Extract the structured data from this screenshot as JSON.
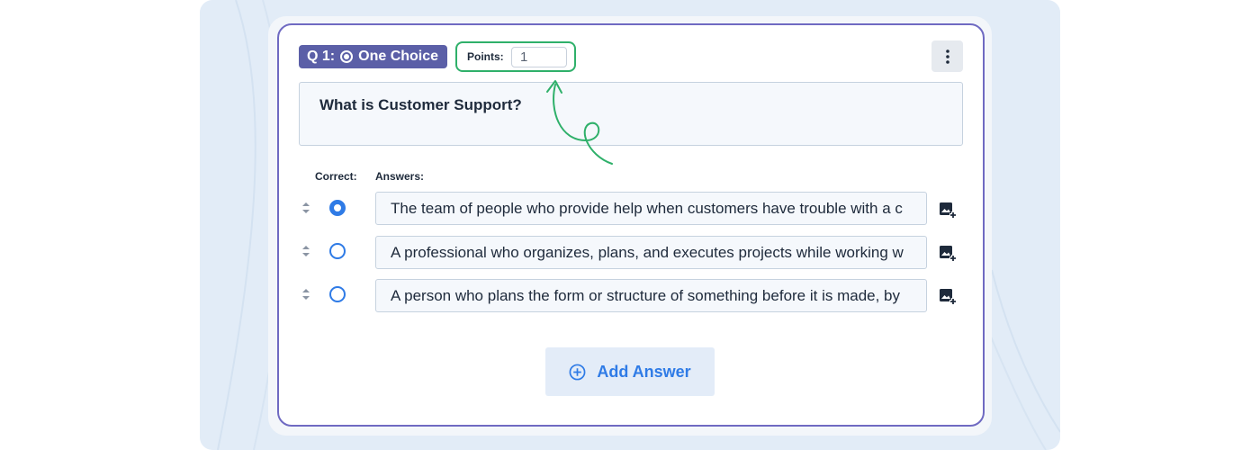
{
  "question": {
    "badge_prefix": "Q 1:",
    "type_label": "One Choice",
    "type_icon": "radio-icon",
    "points_label": "Points:",
    "points_value": "1",
    "menu_icon": "kebab-menu-icon",
    "text": "What is Customer Support?"
  },
  "answers_section": {
    "correct_header": "Correct:",
    "answers_header": "Answers:",
    "items": [
      {
        "text": "The team of people who provide help when customers have trouble with a c",
        "correct": true
      },
      {
        "text": "A professional who organizes, plans, and executes projects while working w",
        "correct": false
      },
      {
        "text": "A person who plans the form or structure of something before it is made, by",
        "correct": false
      }
    ],
    "drag_icon": "drag-handle-icon",
    "add_image_icon": "add-image-icon"
  },
  "add_answer": {
    "label": "Add Answer",
    "icon": "plus-circle-icon"
  },
  "colors": {
    "accent_blue": "#2f7be6",
    "badge_purple": "#5b5fa7",
    "card_border": "#6f6ac2",
    "highlight_green": "#2fb06a",
    "background": "#e2ecf7"
  }
}
